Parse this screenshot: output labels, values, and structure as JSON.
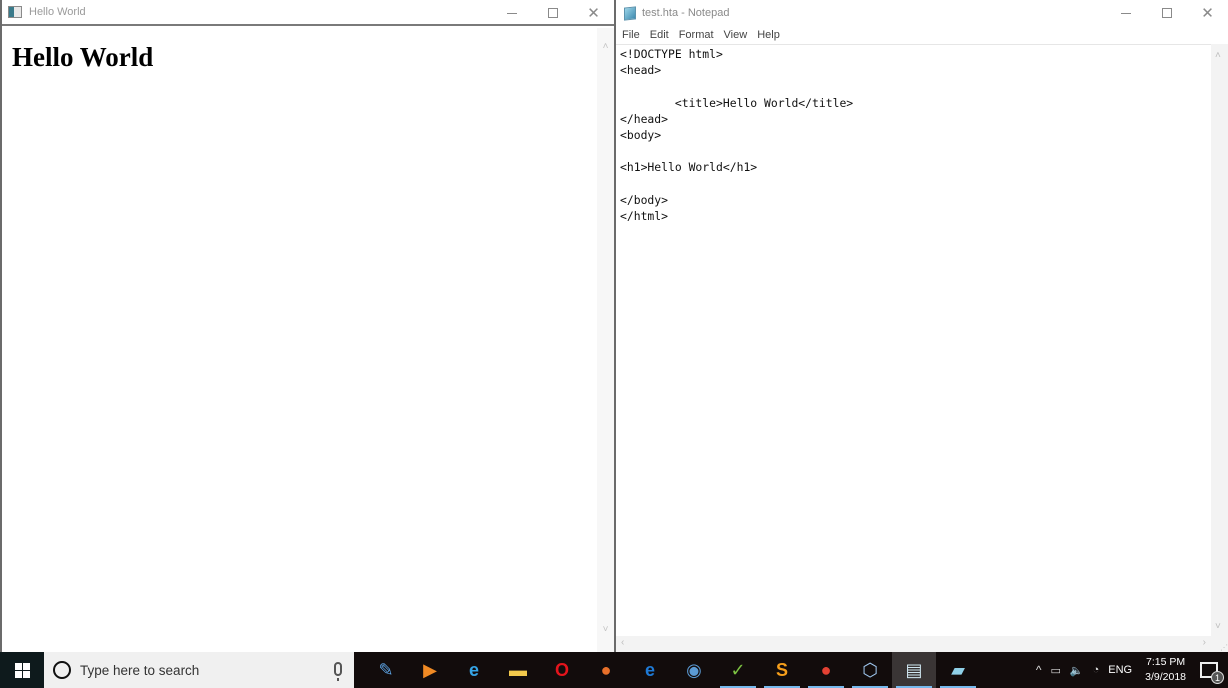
{
  "left_window": {
    "title": "Hello World",
    "icon": "hta-app-icon",
    "heading": "Hello World",
    "controls": {
      "minimize": "minimize-icon",
      "maximize": "maximize-icon",
      "close": "close-icon"
    },
    "scroll_up": "˄",
    "scroll_down": "˅"
  },
  "right_window": {
    "title": "test.hta - Notepad",
    "icon": "notepad-icon",
    "menu": [
      "File",
      "Edit",
      "Format",
      "View",
      "Help"
    ],
    "content": "<!DOCTYPE html>\n<head>\n\n        <title>Hello World</title>\n</head>\n<body>\n\n<h1>Hello World</h1>\n\n</body>\n</html>",
    "scroll_up": "˄",
    "scroll_down": "˅",
    "scroll_left": "‹",
    "scroll_right": "›",
    "size_grip": "⋰"
  },
  "taskbar": {
    "search_placeholder": "Type here to search",
    "pinned_apps": [
      {
        "name": "windows-live-movie-maker",
        "glyph": "✎",
        "color": "#5aa0e0",
        "indicator": false,
        "active": false
      },
      {
        "name": "media-player",
        "glyph": "▶",
        "color": "#f08a24",
        "indicator": false,
        "active": false
      },
      {
        "name": "internet-explorer",
        "glyph": "e",
        "color": "#35a4e6",
        "indicator": false,
        "active": false
      },
      {
        "name": "file-explorer",
        "glyph": "▬",
        "color": "#f2c94c",
        "indicator": false,
        "active": false
      },
      {
        "name": "opera",
        "glyph": "O",
        "color": "#e3141c",
        "indicator": false,
        "active": false
      },
      {
        "name": "firefox",
        "glyph": "●",
        "color": "#e8702a",
        "indicator": false,
        "active": false
      },
      {
        "name": "microsoft-edge",
        "glyph": "e",
        "color": "#1e7ad6",
        "indicator": false,
        "active": false
      },
      {
        "name": "safari",
        "glyph": "◉",
        "color": "#5b9bd5",
        "indicator": false,
        "active": false
      },
      {
        "name": "notepad-plus-plus",
        "glyph": "✓",
        "color": "#7cc242",
        "indicator": true,
        "active": false
      },
      {
        "name": "sublime-text",
        "glyph": "S",
        "color": "#f59e1b",
        "indicator": true,
        "active": false
      },
      {
        "name": "google-chrome",
        "glyph": "●",
        "color": "#e34133",
        "indicator": true,
        "active": false
      },
      {
        "name": "virtualbox",
        "glyph": "⬡",
        "color": "#9fc7ef",
        "indicator": true,
        "active": false
      },
      {
        "name": "hta-window",
        "glyph": "▤",
        "color": "#cfe6f0",
        "indicator": true,
        "active": true
      },
      {
        "name": "notepad",
        "glyph": "▰",
        "color": "#8fd0e8",
        "indicator": true,
        "active": false
      }
    ],
    "tray": {
      "show_hidden": "^",
      "battery": "▭",
      "volume": "🔈",
      "wifi": "◔",
      "language": "ENG",
      "time": "7:15 PM",
      "date": "3/9/2018",
      "notification_count": "1"
    }
  }
}
